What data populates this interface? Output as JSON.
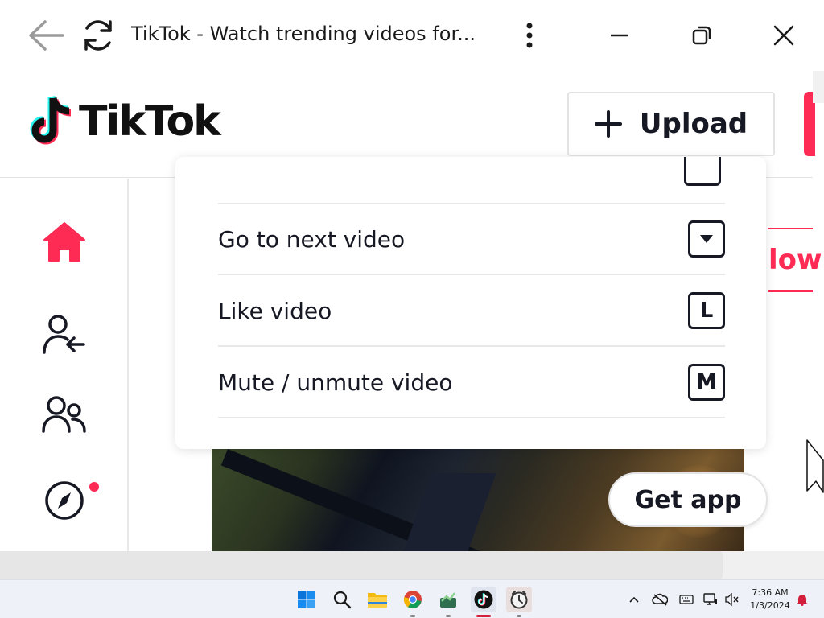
{
  "window": {
    "title": "TikTok - Watch trending videos for...",
    "back_icon": "arrow-left-icon",
    "reload_icon": "refresh-icon",
    "menu_icon": "more-vertical-icon",
    "minimize_icon": "minimize-icon",
    "restore_icon": "restore-icon",
    "close_icon": "close-icon"
  },
  "header": {
    "logo_text": "TikTok",
    "upload_label": "Upload",
    "brand_color": "#fe2c55"
  },
  "sidebar": {
    "items": [
      {
        "icon": "home-icon",
        "active": true
      },
      {
        "icon": "following-icon"
      },
      {
        "icon": "friends-icon"
      },
      {
        "icon": "explore-icon",
        "has_notification": true
      }
    ]
  },
  "shortcuts": {
    "rows": [
      {
        "label": "Go to next video",
        "key": "▼"
      },
      {
        "label": "Like video",
        "key": "L"
      },
      {
        "label": "Mute / unmute video",
        "key": "M"
      }
    ]
  },
  "main": {
    "follow_fragment": "low",
    "get_app_label": "Get app"
  },
  "taskbar": {
    "apps": [
      {
        "name": "start-icon"
      },
      {
        "name": "search-icon"
      },
      {
        "name": "file-explorer-icon"
      },
      {
        "name": "chrome-icon"
      },
      {
        "name": "app-icon"
      },
      {
        "name": "tiktok-icon",
        "active": true
      },
      {
        "name": "clock-app-icon"
      }
    ],
    "time": "7:36 AM",
    "date": "1/3/2024"
  }
}
